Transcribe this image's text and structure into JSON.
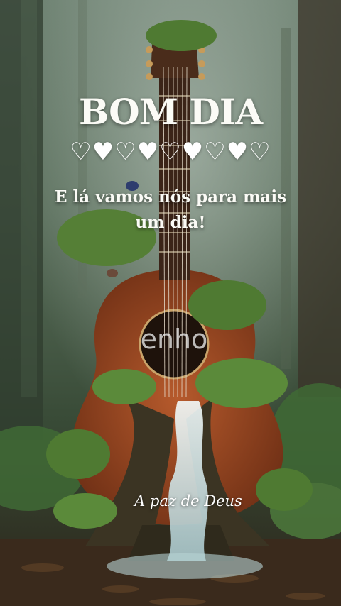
{
  "card": {
    "title": "BOM DIA",
    "hearts": "♡♥♡♥♡♥♡♥♡",
    "message": "E lá vamos nós para mais um dia!",
    "watermark": "enho",
    "signature": "A paz de Deus"
  },
  "colors": {
    "text": "#fbfbf6",
    "guitar_body": "#9c4a25",
    "foliage": "#4f7a32",
    "water": "#d9eef0",
    "forest_bg": "#3d5240"
  }
}
